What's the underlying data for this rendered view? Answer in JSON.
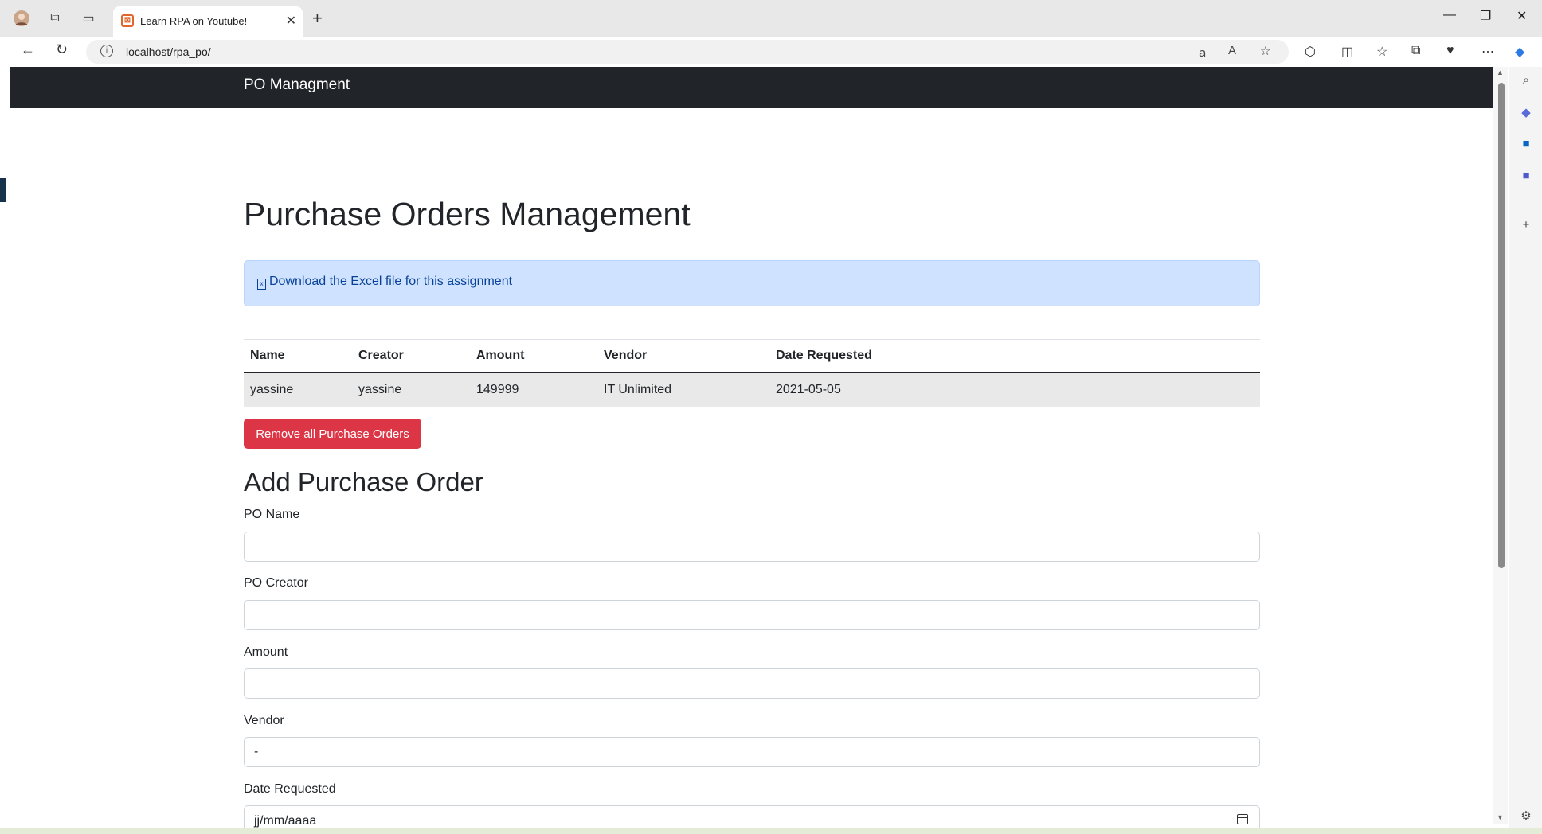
{
  "browser": {
    "tab_title": "Learn RPA on Youtube!",
    "url": "localhost/rpa_po/"
  },
  "navbar": {
    "brand": "PO Managment"
  },
  "page": {
    "title": "Purchase Orders Management",
    "download_link": "Download the Excel file for this assignment"
  },
  "table": {
    "headers": [
      "Name",
      "Creator",
      "Amount",
      "Vendor",
      "Date Requested"
    ],
    "rows": [
      [
        "yassine",
        "yassine",
        "149999",
        "IT Unlimited",
        "2021-05-05"
      ]
    ]
  },
  "remove_button": "Remove all Purchase Orders",
  "form": {
    "heading": "Add Purchase Order",
    "po_name_label": "PO Name",
    "po_name_value": "",
    "po_creator_label": "PO Creator",
    "po_creator_value": "",
    "amount_label": "Amount",
    "amount_value": "",
    "vendor_label": "Vendor",
    "vendor_value": "-",
    "date_label": "Date Requested",
    "date_placeholder": "jj/mm/aaaa"
  },
  "colors": {
    "navbar_bg": "#212529",
    "alert_bg": "#cfe2ff",
    "danger": "#dc3545"
  }
}
